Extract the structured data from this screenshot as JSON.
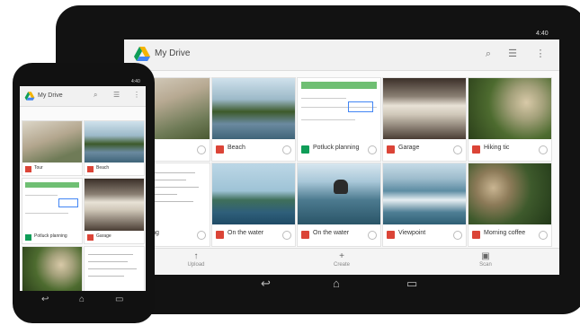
{
  "tablet": {
    "app_title": "My Drive",
    "status_time": "4:40",
    "files": [
      {
        "name": "",
        "type": "image"
      },
      {
        "name": "Beach",
        "type": "image"
      },
      {
        "name": "Potluck planning",
        "type": "sheet"
      },
      {
        "name": "Garage",
        "type": "image"
      },
      {
        "name": "Hiking tic",
        "type": "image"
      },
      {
        "name": "",
        "type": "doc"
      },
      {
        "name": "On the water",
        "type": "image"
      },
      {
        "name": "On the water",
        "type": "image"
      },
      {
        "name": "Viewpoint",
        "type": "image"
      },
      {
        "name": "Morning coffee",
        "type": "image"
      }
    ],
    "partial_caption": "pe Surfing",
    "bottom_actions": [
      {
        "label": "Upload",
        "icon": "upload-icon"
      },
      {
        "label": "Create",
        "icon": "plus-icon"
      },
      {
        "label": "Scan",
        "icon": "camera-icon"
      }
    ]
  },
  "phone": {
    "app_title": "My Drive",
    "status_time": "4:40",
    "files": [
      {
        "name": "Tour",
        "type": "image"
      },
      {
        "name": "Beach",
        "type": "image"
      },
      {
        "name": "Potluck planning",
        "type": "sheet"
      },
      {
        "name": "Garage",
        "type": "image"
      }
    ]
  },
  "colors": {
    "image_icon": "#db4437",
    "sheet_icon": "#0f9d58",
    "drive_green": "#0f9d58",
    "drive_yellow": "#f4b400",
    "drive_blue": "#4285f4"
  }
}
